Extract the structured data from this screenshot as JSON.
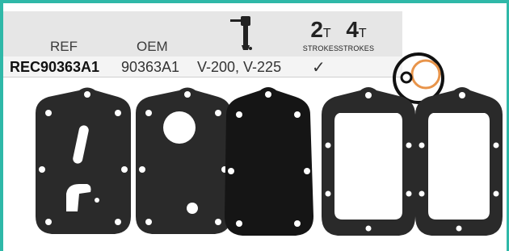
{
  "table": {
    "headers": {
      "ref": "REF",
      "oem": "OEM"
    },
    "strokes": [
      {
        "num": "2",
        "sub": "T",
        "label": "STROKES"
      },
      {
        "num": "4",
        "sub": "T",
        "label": "STROKES"
      }
    ],
    "row": {
      "ref": "REC90363A1",
      "oem": "90363A1",
      "models": "V-200, V-225",
      "check": "✓"
    }
  },
  "icons": [
    "outboard-motor-icon",
    "checkmark-icon"
  ],
  "colors": {
    "frame": "#2fb8a8",
    "gasket": "#2a2a2a",
    "oring": "#e8944a",
    "header_bg": "#e6e6e6"
  }
}
